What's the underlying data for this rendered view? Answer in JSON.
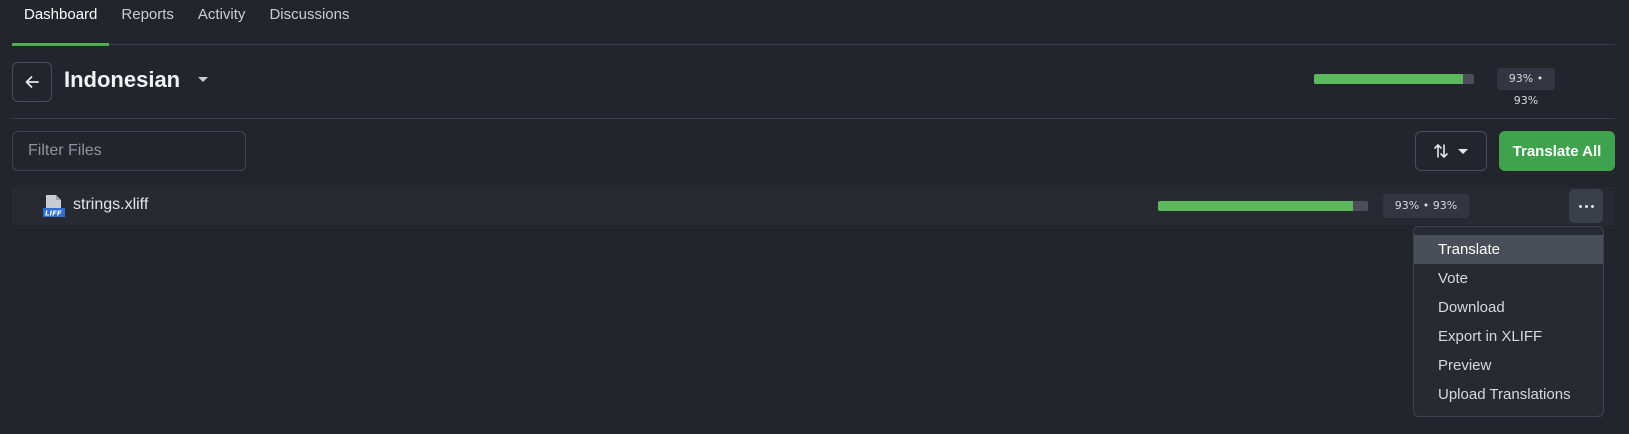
{
  "tabs": [
    {
      "label": "Dashboard",
      "active": true
    },
    {
      "label": "Reports"
    },
    {
      "label": "Activity"
    },
    {
      "label": "Discussions"
    }
  ],
  "header": {
    "language": "Indonesian",
    "progress": {
      "translated_pct": 93,
      "approved_pct": 93,
      "label": "93% • 93%"
    }
  },
  "toolbar": {
    "filter_placeholder": "Filter Files",
    "translate_all_label": "Translate All",
    "accent_color": "#3fa34d"
  },
  "files": [
    {
      "name": "strings.xliff",
      "icon": "xliff-file-icon",
      "icon_text": "LIFF",
      "progress": {
        "translated_pct": 93,
        "approved_pct": 93,
        "label": "93% • 93%"
      }
    }
  ],
  "menu": {
    "items": [
      "Translate",
      "Vote",
      "Download",
      "Export in XLIFF",
      "Preview",
      "Upload Translations"
    ],
    "highlighted": "Translate"
  }
}
